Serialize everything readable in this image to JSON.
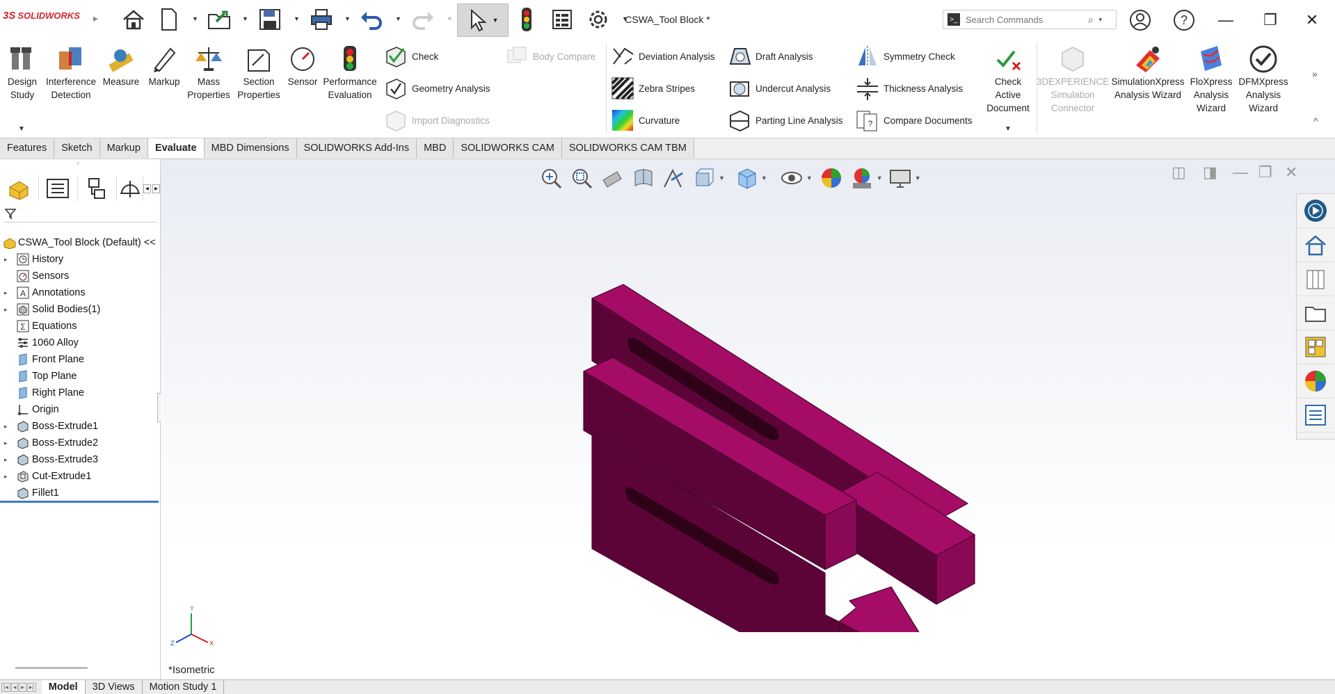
{
  "app": {
    "logo_text": "SOLIDWORKS",
    "document_title": "CSWA_Tool Block *",
    "search_placeholder": "Search Commands"
  },
  "ribbon": {
    "large_buttons": [
      {
        "id": "design-study",
        "label": "Design Study",
        "icon": "design-study-icon"
      },
      {
        "id": "interference",
        "label": "Interference Detection",
        "icon": "interference-icon"
      },
      {
        "id": "measure",
        "label": "Measure",
        "icon": "measure-icon"
      },
      {
        "id": "markup",
        "label": "Markup",
        "icon": "markup-icon"
      },
      {
        "id": "mass",
        "label": "Mass Properties",
        "icon": "mass-properties-icon"
      },
      {
        "id": "section",
        "label": "Section Properties",
        "icon": "section-properties-icon"
      },
      {
        "id": "sensor",
        "label": "Sensor",
        "icon": "sensor-icon"
      },
      {
        "id": "performance",
        "label": "Performance Evaluation",
        "icon": "performance-icon"
      }
    ],
    "check": "Check",
    "geometry_analysis": "Geometry Analysis",
    "import_diagnostics": "Import Diagnostics",
    "body_compare": "Body Compare",
    "deviation_analysis": "Deviation Analysis",
    "zebra_stripes": "Zebra Stripes",
    "curvature": "Curvature",
    "draft_analysis": "Draft Analysis",
    "undercut_analysis": "Undercut Analysis",
    "parting_line_analysis": "Parting Line Analysis",
    "symmetry_check": "Symmetry Check",
    "thickness_analysis": "Thickness Analysis",
    "compare_documents": "Compare Documents",
    "check_active_document": "Check Active Document",
    "simulation_connector": "3DEXPERIENCE Simulation Connector",
    "simulationxpress": "SimulationXpress Analysis Wizard",
    "floxpress": "FloXpress Analysis Wizard",
    "dfmxpress": "DFMXpress Analysis Wizard"
  },
  "tabs": [
    "Features",
    "Sketch",
    "Markup",
    "Evaluate",
    "MBD Dimensions",
    "SOLIDWORKS Add-Ins",
    "MBD",
    "SOLIDWORKS CAM",
    "SOLIDWORKS CAM TBM"
  ],
  "active_tab": "Evaluate",
  "tree": {
    "root": "CSWA_Tool Block (Default) <<",
    "items": [
      {
        "label": "History",
        "expandable": true,
        "icon": "history-icon"
      },
      {
        "label": "Sensors",
        "expandable": false,
        "icon": "sensors-icon"
      },
      {
        "label": "Annotations",
        "expandable": true,
        "icon": "annotations-icon"
      },
      {
        "label": "Solid Bodies(1)",
        "expandable": true,
        "icon": "solid-bodies-icon"
      },
      {
        "label": "Equations",
        "expandable": false,
        "icon": "equations-icon"
      },
      {
        "label": "1060 Alloy",
        "expandable": false,
        "icon": "material-icon"
      },
      {
        "label": "Front Plane",
        "expandable": false,
        "icon": "plane-icon"
      },
      {
        "label": "Top Plane",
        "expandable": false,
        "icon": "plane-icon"
      },
      {
        "label": "Right Plane",
        "expandable": false,
        "icon": "plane-icon"
      },
      {
        "label": "Origin",
        "expandable": false,
        "icon": "origin-icon"
      },
      {
        "label": "Boss-Extrude1",
        "expandable": true,
        "icon": "extrude-icon"
      },
      {
        "label": "Boss-Extrude2",
        "expandable": true,
        "icon": "extrude-icon"
      },
      {
        "label": "Boss-Extrude3",
        "expandable": true,
        "icon": "extrude-icon"
      },
      {
        "label": "Cut-Extrude1",
        "expandable": true,
        "icon": "cut-extrude-icon"
      },
      {
        "label": "Fillet1",
        "expandable": false,
        "icon": "fillet-icon"
      }
    ]
  },
  "viewport": {
    "view_label": "*Isometric",
    "triad": {
      "x": "X",
      "y": "Y",
      "z": "Z"
    },
    "part_color": "#9b0a5e"
  },
  "bottom_tabs": [
    "Model",
    "3D Views",
    "Motion Study 1"
  ],
  "active_bottom_tab": "Model"
}
